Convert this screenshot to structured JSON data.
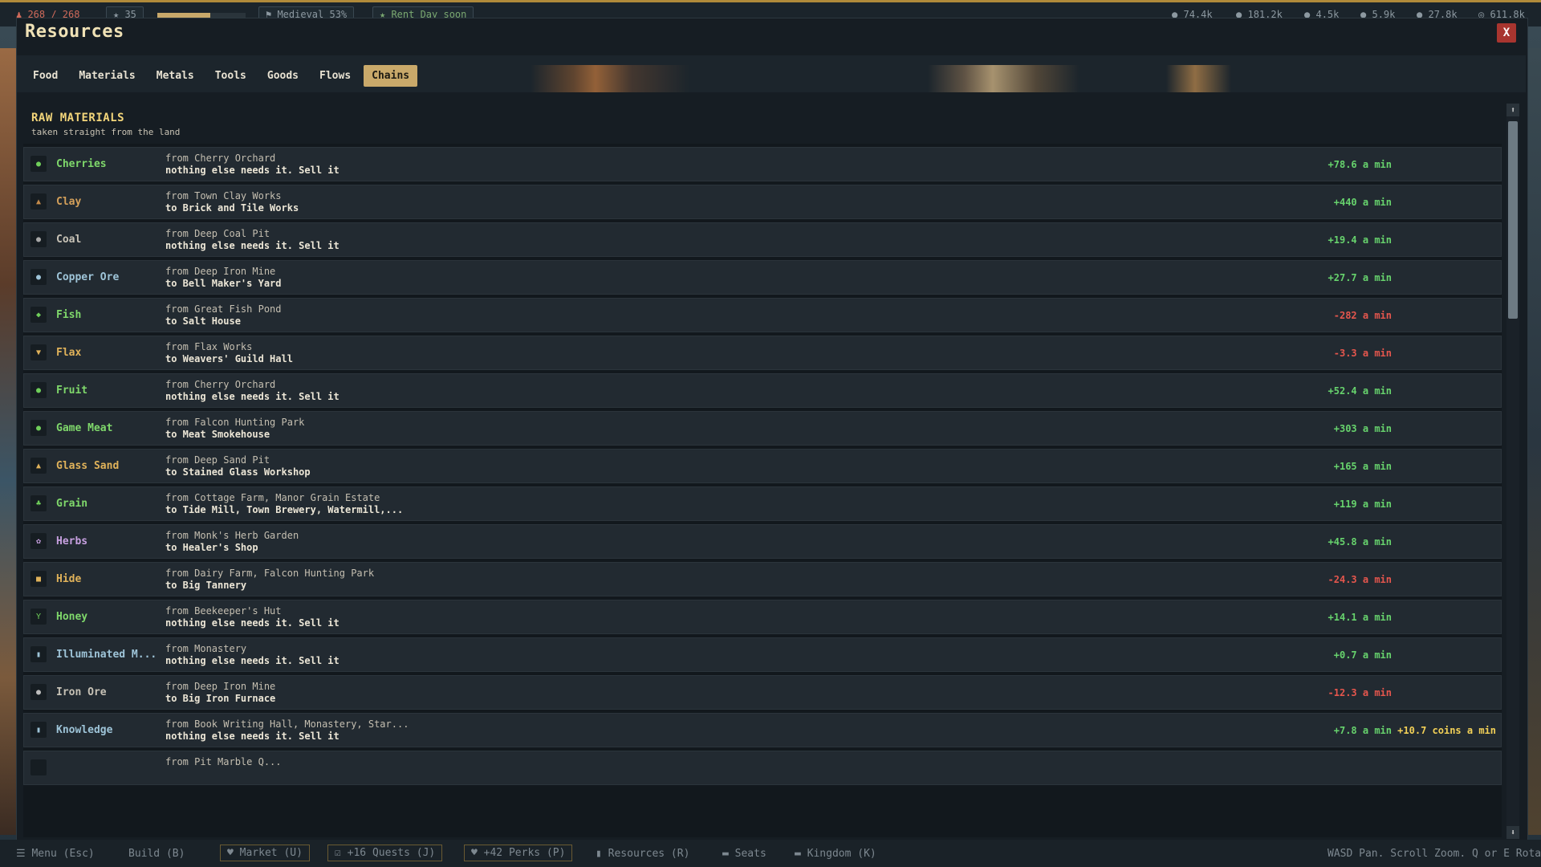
{
  "top_hud": {
    "population": "268 / 268",
    "stars": "35",
    "progress_fraction": 0.6,
    "era": "Medieval 53%",
    "event": "Rent Day soon",
    "stats": [
      "74.4k",
      "181.2k",
      "4.5k",
      "5.9k",
      "27.8k",
      "611.8k"
    ]
  },
  "panel": {
    "title": "Resources",
    "close_label": "X",
    "tabs": [
      "Food",
      "Materials",
      "Metals",
      "Tools",
      "Goods",
      "Flows",
      "Chains"
    ],
    "active_tab": "Chains"
  },
  "section": {
    "title": "RAW MATERIALS",
    "subtitle": "taken straight from the land"
  },
  "rows": [
    {
      "name": "Cherries",
      "from": "from Cherry Orchard",
      "to": "nothing else needs it. Sell it",
      "rate": "+78.6 a min",
      "rate_sign": "pos",
      "name_color": "#7fd86b",
      "icon": "apple-icon",
      "glyph": "●",
      "icon_color": "#6fcf5a"
    },
    {
      "name": "Clay",
      "from": "from Town Clay Works",
      "to": "to Brick and Tile Works",
      "rate": "+440 a min",
      "rate_sign": "pos",
      "name_color": "#d4a05a",
      "icon": "clay-icon",
      "glyph": "▲",
      "icon_color": "#c28a4a"
    },
    {
      "name": "Coal",
      "from": "from Deep Coal Pit",
      "to": "nothing else needs it. Sell it",
      "rate": "+19.4 a min",
      "rate_sign": "pos",
      "name_color": "#c7c2b6",
      "icon": "coal-icon",
      "glyph": "●",
      "icon_color": "#a8a8a8"
    },
    {
      "name": "Copper Ore",
      "from": "from Deep Iron Mine",
      "to": "to Bell Maker's Yard",
      "rate": "+27.7 a min",
      "rate_sign": "pos",
      "name_color": "#9ec4d8",
      "icon": "ore-icon",
      "glyph": "●",
      "icon_color": "#9ec4d8"
    },
    {
      "name": "Fish",
      "from": "from Great Fish Pond",
      "to": "to Salt House",
      "rate": "-282 a min",
      "rate_sign": "neg",
      "name_color": "#7fd86b",
      "icon": "fish-icon",
      "glyph": "◆",
      "icon_color": "#6fcf5a"
    },
    {
      "name": "Flax",
      "from": "from Flax Works",
      "to": "to Weavers' Guild Hall",
      "rate": "-3.3 a min",
      "rate_sign": "neg",
      "name_color": "#e0b25a",
      "icon": "flax-icon",
      "glyph": "▼",
      "icon_color": "#e0b25a"
    },
    {
      "name": "Fruit",
      "from": "from Cherry Orchard",
      "to": "nothing else needs it. Sell it",
      "rate": "+52.4 a min",
      "rate_sign": "pos",
      "name_color": "#7fd86b",
      "icon": "fruit-icon",
      "glyph": "●",
      "icon_color": "#6fcf5a"
    },
    {
      "name": "Game Meat",
      "from": "from Falcon Hunting Park",
      "to": "to Meat Smokehouse",
      "rate": "+303 a min",
      "rate_sign": "pos",
      "name_color": "#7fd86b",
      "icon": "meat-icon",
      "glyph": "●",
      "icon_color": "#6fcf5a"
    },
    {
      "name": "Glass Sand",
      "from": "from Deep Sand Pit",
      "to": "to Stained Glass Workshop",
      "rate": "+165 a min",
      "rate_sign": "pos",
      "name_color": "#e0b25a",
      "icon": "sand-icon",
      "glyph": "▲",
      "icon_color": "#e0b25a"
    },
    {
      "name": "Grain",
      "from": "from Cottage Farm, Manor Grain Estate",
      "to": "to Tide Mill, Town Brewery, Watermill,...",
      "rate": "+119 a min",
      "rate_sign": "pos",
      "name_color": "#7fd86b",
      "icon": "grain-icon",
      "glyph": "♣",
      "icon_color": "#6fcf5a"
    },
    {
      "name": "Herbs",
      "from": "from Monk's Herb Garden",
      "to": "to Healer's Shop",
      "rate": "+45.8 a min",
      "rate_sign": "pos",
      "name_color": "#c7a0e0",
      "icon": "herb-icon",
      "glyph": "✿",
      "icon_color": "#c7a0e0"
    },
    {
      "name": "Hide",
      "from": "from Dairy Farm, Falcon Hunting Park",
      "to": "to Big Tannery",
      "rate": "-24.3 a min",
      "rate_sign": "neg",
      "name_color": "#e0b25a",
      "icon": "hide-icon",
      "glyph": "■",
      "icon_color": "#e0b25a"
    },
    {
      "name": "Honey",
      "from": "from Beekeeper's Hut",
      "to": "nothing else needs it. Sell it",
      "rate": "+14.1 a min",
      "rate_sign": "pos",
      "name_color": "#7fd86b",
      "icon": "honey-icon",
      "glyph": "Y",
      "icon_color": "#6fcf5a"
    },
    {
      "name": "Illuminated M...",
      "from": "from Monastery",
      "to": "nothing else needs it. Sell it",
      "rate": "+0.7 a min",
      "rate_sign": "pos",
      "name_color": "#9ec4d8",
      "icon": "book-icon",
      "glyph": "▮",
      "icon_color": "#9ec4d8"
    },
    {
      "name": "Iron Ore",
      "from": "from Deep Iron Mine",
      "to": "to Big Iron Furnace",
      "rate": "-12.3 a min",
      "rate_sign": "neg",
      "name_color": "#c7c2b6",
      "icon": "iron-ore-icon",
      "glyph": "●",
      "icon_color": "#bdbdbd"
    },
    {
      "name": "Knowledge",
      "from": "from Book Writing Hall, Monastery, Star...",
      "to": "nothing else needs it. Sell it",
      "rate": "+7.8 a min",
      "rate_sign": "pos",
      "coins": "+10.7 coins a min",
      "name_color": "#9ec4d8",
      "icon": "knowledge-icon",
      "glyph": "▮",
      "icon_color": "#9ec4d8"
    },
    {
      "name": "",
      "from": "from Pit Marble Q...",
      "to": "",
      "rate": "",
      "rate_sign": "pos",
      "name_color": "#c7c2b6",
      "icon": "marble-icon",
      "glyph": "",
      "icon_color": "#bdbdbd"
    }
  ],
  "scrollbar": {
    "up_label": "⬆",
    "down_label": "⬇"
  },
  "bottom_bar": {
    "menu": "☰ Menu (Esc)",
    "build": "Build (B)",
    "market": "♥ Market (U)",
    "quests": "☑ +16 Quests (J)",
    "perks": "♥ +42 Perks (P)",
    "resources": "▮ Resources (R)",
    "seats": "▬ Seats",
    "kingdom": "▬ Kingdom (K)",
    "hint": "WASD Pan. Scroll Zoom. Q or E Rotate"
  },
  "colors": {
    "accent": "#c9a96a",
    "close": "#a8352f",
    "positive": "#67d36d",
    "negative": "#e5564d",
    "coins": "#f2d057",
    "section_title": "#f2d57a"
  }
}
